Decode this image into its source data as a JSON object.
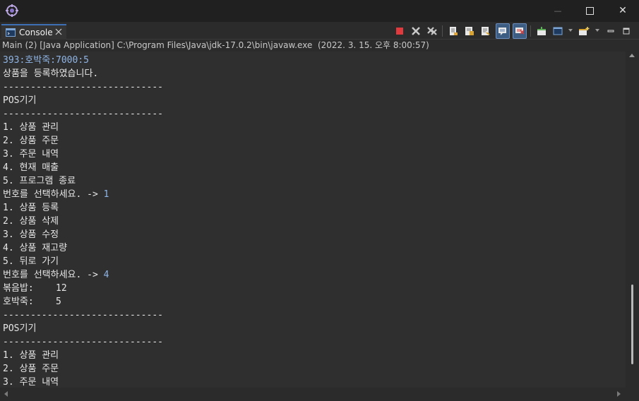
{
  "window": {
    "minimize_glyph": "—",
    "close_glyph": "✕"
  },
  "view": {
    "tab_label": "Console"
  },
  "status": {
    "launch_info": "Main (2) [Java Application] C:\\Program Files\\Java\\jdk-17.0.2\\bin\\javaw.exe  (2022. 3. 15. 오후 8:00:57)"
  },
  "console": {
    "lines": [
      "393:호박죽:7000:5",
      "상품을 등록하였습니다.",
      "-----------------------------",
      "POS기기",
      "-----------------------------",
      "1. 상품 관리",
      "2. 상품 주문",
      "3. 주문 내역",
      "4. 현재 매출",
      "5. 프로그램 종료",
      "번호를 선택하세요. -> ",
      "1. 상품 등록",
      "2. 상품 삭제",
      "3. 상품 수정",
      "4. 상품 재고량",
      "5. 뒤로 가기",
      "번호를 선택하세요. -> ",
      "볶음밥:    12",
      "호박죽:    5",
      "-----------------------------",
      "POS기기",
      "-----------------------------",
      "1. 상품 관리",
      "2. 상품 주문",
      "3. 주문 내역"
    ],
    "user_inputs": [
      "1",
      "4"
    ]
  },
  "colors": {
    "accent": "#3d6fb5",
    "input_text": "#8fb5e6",
    "background": "#2f2f2f"
  }
}
